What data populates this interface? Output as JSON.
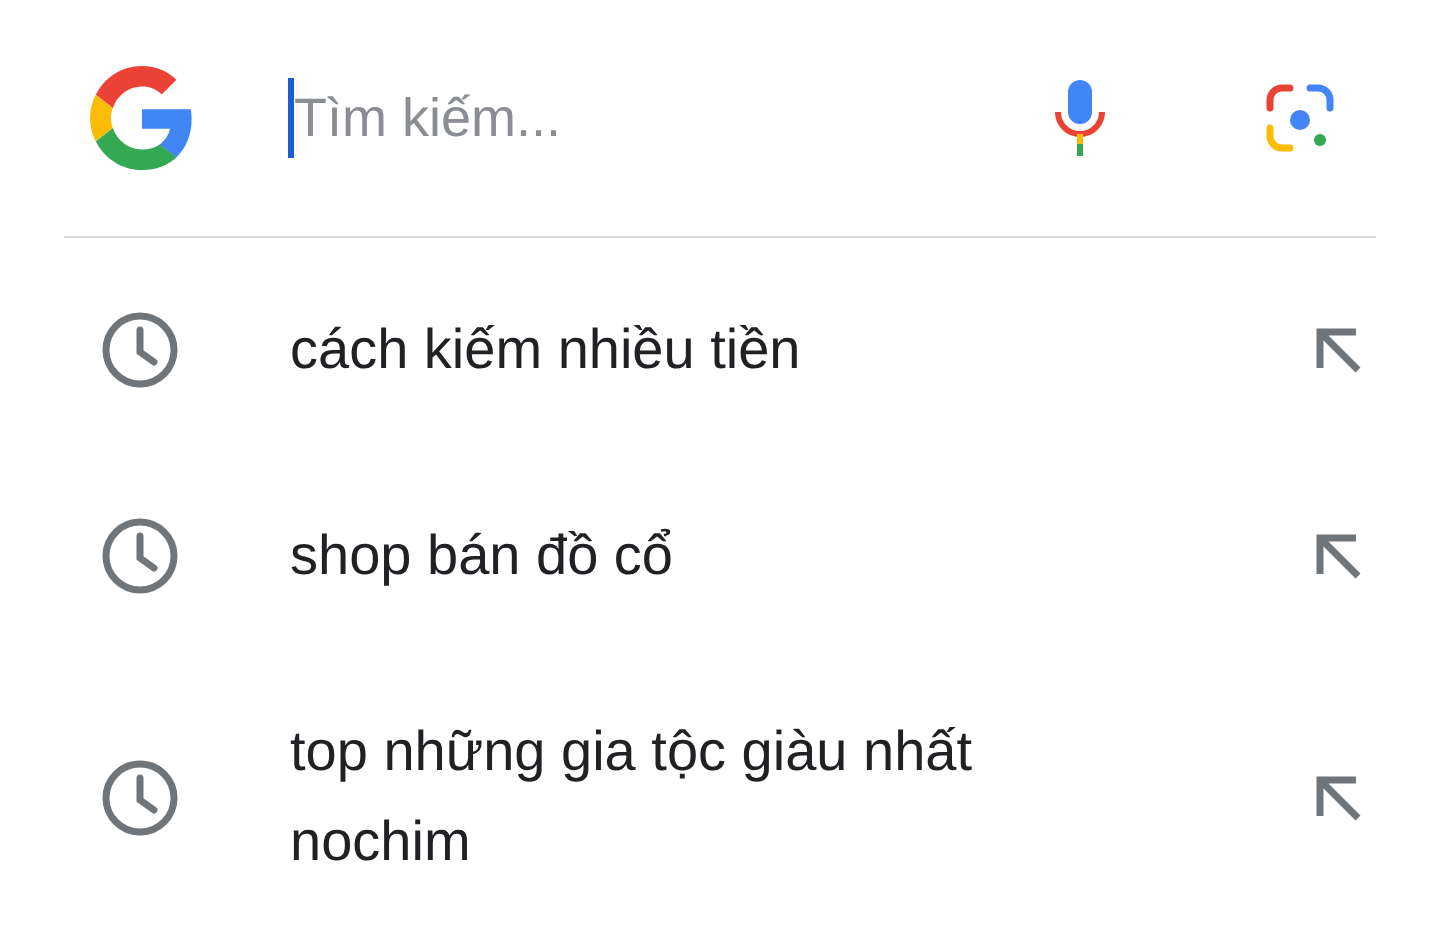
{
  "search": {
    "placeholder": "Tìm kiếm...",
    "focused": true
  },
  "suggestions": [
    {
      "text": "cách kiếm nhiều tiền"
    },
    {
      "text": "shop bán đồ cổ"
    },
    {
      "text": "top những gia tộc giàu nhất nochim"
    }
  ]
}
